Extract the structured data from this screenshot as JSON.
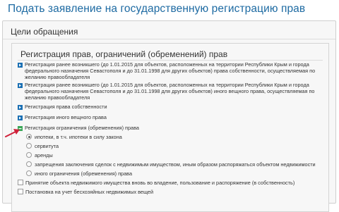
{
  "page": {
    "title": "Подать заявление на государственную регистрацию прав"
  },
  "panel": {
    "title": "Цели обращения"
  },
  "section": {
    "title": "Регистрация прав, ограничений (обременений) прав"
  },
  "options": [
    {
      "lines": [
        "Регистрация ранее возникшего (до 1.01.2015 для объектов, расположенных на территории Республики Крым и города",
        "федерального назначения Севастополя и до 31.01.1998 для других объектов) права собственности, осуществляемая по",
        "желанию правообладателя"
      ]
    },
    {
      "lines": [
        "Регистрация ранее возникшего (до 1.01.2015 для объектов, расположенных на территории Республики Крым и города",
        "федерального назначения Севастополя и до 31.01.1998 для других объектов) иного вещного права, осуществляемая по",
        "желанию правообладателя"
      ]
    },
    {
      "lines": [
        "Регистрация права собственности"
      ]
    },
    {
      "lines": [
        "Регистрация иного вещного права"
      ]
    },
    {
      "lines": [
        "Регистрация ограничения (обременения) права"
      ]
    }
  ],
  "radios": [
    {
      "label": "ипотеки, в т.ч. ипотеки в силу закона",
      "checked": true
    },
    {
      "label": "сервитута",
      "checked": false
    },
    {
      "label": "аренды",
      "checked": false
    },
    {
      "label": "запрещения заключения сделок с недвижимым имуществом, иным образом распоряжаться объектом недвижимости",
      "checked": false
    },
    {
      "label": "иного ограничения (обременения) права",
      "checked": false
    }
  ],
  "checkboxes": [
    {
      "label": "Принятие объекта недвижимого имущества вновь во владение, пользование и распоряжение (в собственность)"
    },
    {
      "label": "Постановка на учет бесхозяйных недвижимых вещей"
    }
  ],
  "colors": {
    "title": "#1d6aa2",
    "expand_icon": "#1a6fb3",
    "expanded_icon": "#3aa657",
    "arrow": "#d0213a"
  },
  "icons": {
    "collapsed": "expand-arrow-icon",
    "expanded": "collapse-minus-icon",
    "pointer": "red-arrow-icon"
  }
}
